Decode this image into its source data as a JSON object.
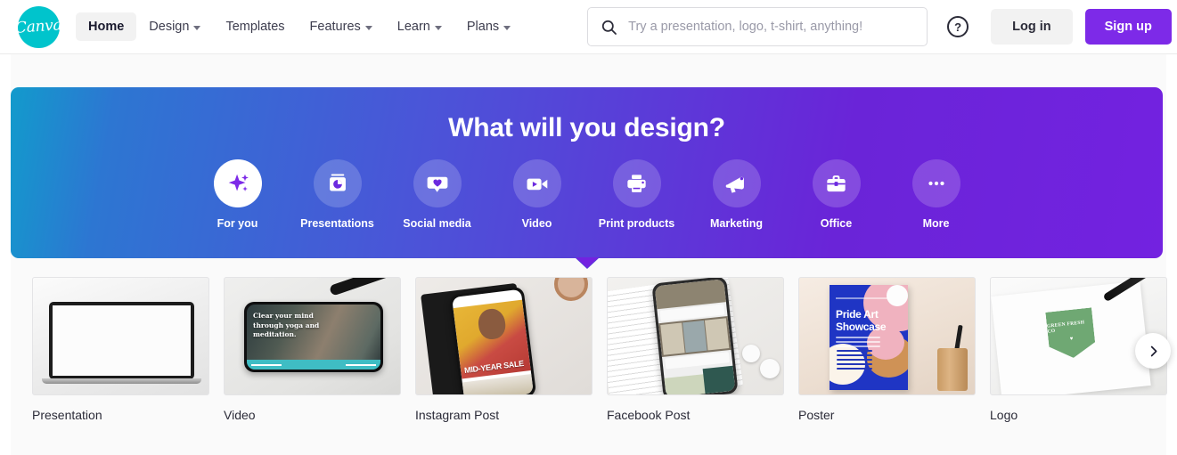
{
  "brand": {
    "name": "Canva",
    "logo_color": "#00c4cc"
  },
  "header": {
    "nav": [
      {
        "label": "Home",
        "active": true,
        "caret": false
      },
      {
        "label": "Design",
        "active": false,
        "caret": true
      },
      {
        "label": "Templates",
        "active": false,
        "caret": false
      },
      {
        "label": "Features",
        "active": false,
        "caret": true
      },
      {
        "label": "Learn",
        "active": false,
        "caret": true
      },
      {
        "label": "Plans",
        "active": false,
        "caret": true
      }
    ],
    "search": {
      "placeholder": "Try a presentation, logo, t-shirt, anything!",
      "value": "",
      "icon": "search-icon"
    },
    "help_icon": "?",
    "login_label": "Log in",
    "signup_label": "Sign up",
    "signup_color": "#7d2ae8"
  },
  "hero": {
    "title": "What will you design?",
    "gradient_from": "#2d76d2",
    "gradient_to": "#7322e0",
    "categories": [
      {
        "label": "For you",
        "icon": "sparkle-icon",
        "active": true
      },
      {
        "label": "Presentations",
        "icon": "presentation-icon",
        "active": false
      },
      {
        "label": "Social media",
        "icon": "heart-bubble-icon",
        "active": false
      },
      {
        "label": "Video",
        "icon": "video-camera-icon",
        "active": false
      },
      {
        "label": "Print products",
        "icon": "printer-icon",
        "active": false
      },
      {
        "label": "Marketing",
        "icon": "megaphone-icon",
        "active": false
      },
      {
        "label": "Office",
        "icon": "briefcase-icon",
        "active": false
      },
      {
        "label": "More",
        "icon": "ellipsis-icon",
        "active": false
      }
    ]
  },
  "cards": [
    {
      "label": "Presentation",
      "art": "laptop-mockup"
    },
    {
      "label": "Video",
      "art": "phone-yoga-video",
      "overlay_text": "Clear your mind through yoga and meditation."
    },
    {
      "label": "Instagram Post",
      "art": "phone-instagram",
      "overlay_text": "MID-YEAR SALE"
    },
    {
      "label": "Facebook Post",
      "art": "phone-facebook"
    },
    {
      "label": "Poster",
      "art": "pride-art-poster",
      "overlay_text": "Pride Art Showcase"
    },
    {
      "label": "Logo",
      "art": "green-fresh-logo",
      "overlay_text": "GREEN FRESH CO"
    }
  ],
  "carousel": {
    "next_icon": "chevron-right-icon"
  }
}
